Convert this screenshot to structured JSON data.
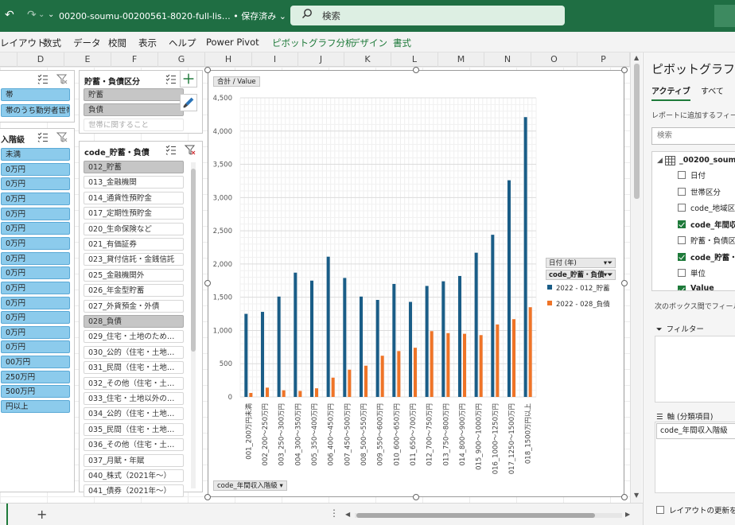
{
  "colors": {
    "title_bg": "#1f6e43",
    "series1": "#1a5d87",
    "series2": "#ef7427",
    "slicer_selected": "#8ccbec",
    "accent_green": "#1e7a3a"
  },
  "titlebar": {
    "doc_title": "00200-soumu-00200561-8020-full-lis… • 保存済み ⌄",
    "search_placeholder": "検索"
  },
  "ribbon": {
    "items": [
      "レイアウト",
      "数式",
      "データ",
      "校閲",
      "表示",
      "ヘルプ",
      "Power Pivot",
      "ピボットグラフ分析",
      "デザイン",
      "書式"
    ]
  },
  "columns": [
    "D",
    "E",
    "F",
    "G",
    "H",
    "I",
    "J",
    "K",
    "L",
    "M",
    "N",
    "O",
    "P"
  ],
  "slicer_setai": {
    "items": [
      "帯",
      "帯のうち勤労者世帯"
    ]
  },
  "slicer_income": {
    "title": "入階級",
    "items": [
      "未満",
      "0万円",
      "0万円",
      "0万円",
      "0万円",
      "0万円",
      "0万円",
      "0万円",
      "0万円",
      "0万円",
      "0万円",
      "0万円",
      "0万円",
      "0万円",
      "00万円",
      "250万円",
      "500万円",
      "円以上"
    ]
  },
  "slicer_saving": {
    "title": "貯蓄・負債区分",
    "items": [
      "貯蓄",
      "負債",
      "世帯に関すること"
    ]
  },
  "slicer_code": {
    "title": "code_貯蓄・負債",
    "items": [
      "012_貯蓄",
      "013_金融機関",
      "014_通貨性預貯金",
      "017_定期性預貯金",
      "020_生命保険など",
      "021_有価証券",
      "023_貸付信託・金銭信託",
      "025_金融機関外",
      "026_年金型貯蓄",
      "027_外貨預金・外債",
      "028_負債",
      "029_住宅・土地のため…",
      "030_公的（住宅・土地…",
      "031_民間（住宅・土地…",
      "032_その他（住宅・土…",
      "033_住宅・土地以外の…",
      "034_公的（住宅・土地…",
      "035_民間（住宅・土地…",
      "036_その他（住宅・土…",
      "037_月賦・年賦",
      "040_株式（2021年〜）",
      "041_債券（2021年〜）"
    ]
  },
  "chart": {
    "value_field_button": "合計 / Value",
    "axis_field_button": "code_年間収入階級 ▾",
    "legend_date_button": "日付 (年)",
    "legend_code_button": "code_貯蓄・負債"
  },
  "chart_data": {
    "type": "bar",
    "title": "",
    "xlabel": "",
    "ylabel": "",
    "ylim": [
      0,
      4500
    ],
    "yticks": [
      0,
      500,
      1000,
      1500,
      2000,
      2500,
      3000,
      3500,
      4000,
      4500
    ],
    "ytick_labels": [
      "0",
      "500",
      "1,000",
      "1,500",
      "2,000",
      "2,500",
      "3,000",
      "3,500",
      "4,000",
      "4,500"
    ],
    "grid": true,
    "legend_position": "right",
    "categories": [
      "001_200万円未満",
      "002_200～250万円",
      "003_250～300万円",
      "004_300～350万円",
      "005_350～400万円",
      "006_400～450万円",
      "007_450～500万円",
      "008_500～550万円",
      "009_550～600万円",
      "010_600～650万円",
      "011_650～700万円",
      "012_700～750万円",
      "013_750～800万円",
      "014_800～900万円",
      "015_900～1000万円",
      "016_1000～1250万円",
      "017_1250～1500万円",
      "018_1500万円以上"
    ],
    "series": [
      {
        "name": "2022 - 012_貯蓄",
        "color": "#1a5d87",
        "values": [
          1250,
          1280,
          1510,
          1870,
          1750,
          2110,
          1790,
          1510,
          1460,
          1700,
          1430,
          1670,
          1740,
          1820,
          2170,
          2440,
          3260,
          4210
        ]
      },
      {
        "name": "2022 - 028_負債",
        "color": "#ef7427",
        "values": [
          60,
          140,
          100,
          90,
          130,
          290,
          410,
          470,
          620,
          690,
          740,
          990,
          960,
          950,
          930,
          1090,
          1170,
          1350
        ]
      }
    ]
  },
  "pane": {
    "title": "ピボットグラフの",
    "tab_active": "アクティブ",
    "tab_all": "すべて",
    "hint": "レポートに追加するフィール",
    "search_placeholder": "検索",
    "table_name": "_00200_soum",
    "fields": [
      {
        "label": "日付",
        "checked": false
      },
      {
        "label": "世帯区分",
        "checked": false
      },
      {
        "label": "code_地域区",
        "checked": false
      },
      {
        "label": "code_年間収",
        "checked": true
      },
      {
        "label": "貯蓄・負債区",
        "checked": false
      },
      {
        "label": "code_貯蓄・",
        "checked": true
      },
      {
        "label": "単位",
        "checked": false
      },
      {
        "label": "Value",
        "checked": true
      }
    ],
    "drag_hint": "次のボックス間でフィールド",
    "filter_label": "フィルター",
    "axis_label": "軸 (分類項目)",
    "axis_chip": "code_年間収入階級",
    "defer_label": "レイアウトの更新を保"
  }
}
